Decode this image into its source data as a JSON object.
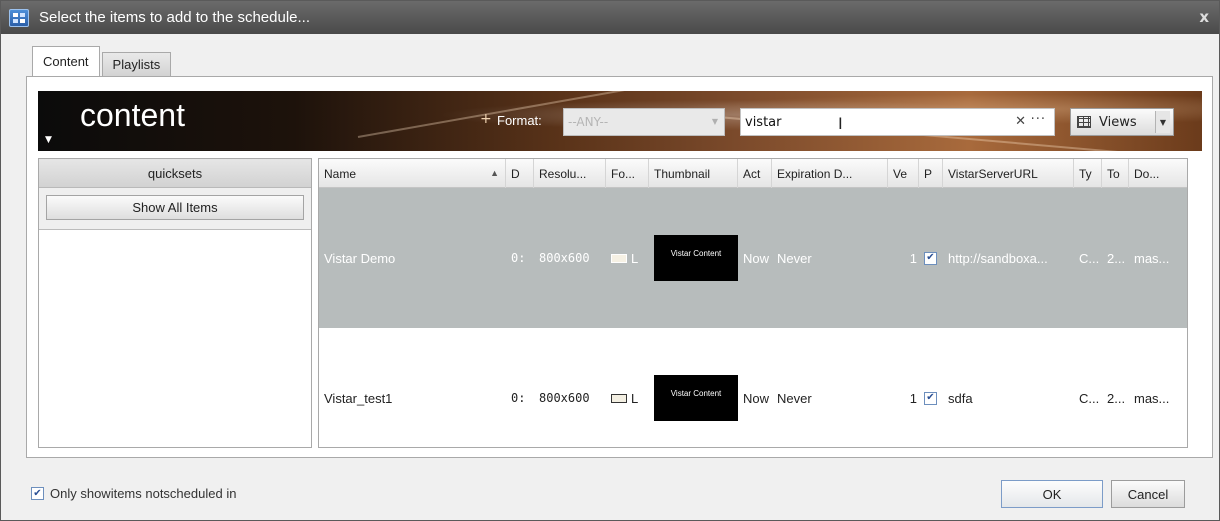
{
  "window": {
    "title": "Select the items to add to the schedule...",
    "close": "x"
  },
  "tabs": [
    {
      "label": "Content",
      "active": true
    },
    {
      "label": "Playlists",
      "active": false
    }
  ],
  "banner": {
    "title": "content",
    "format_label": "Format:",
    "format_value": "--ANY--",
    "search_value": "vistar",
    "search_clear": "✕",
    "search_more": "···",
    "views_label": "Views"
  },
  "quicksets": {
    "header": "quicksets",
    "show_all": "Show All Items"
  },
  "grid": {
    "columns": [
      "Name",
      "D",
      "Resolu...",
      "Fo...",
      "Thumbnail",
      "Act",
      "Expiration D...",
      "Ve",
      "P",
      "VistarServerURL",
      "Ty",
      "To",
      "Do..."
    ],
    "sort": "ascending",
    "rows": [
      {
        "name": "Vistar Demo",
        "d": "0:",
        "resolution": "800x600",
        "format": "L",
        "thumbnail": "Vistar Content",
        "act": "Now",
        "expiration": "Never",
        "ve": "1",
        "p": true,
        "url": "http://sandboxa...",
        "ty": "C...",
        "to": "2...",
        "do": "mas...",
        "selected": true
      },
      {
        "name": "Vistar_test1",
        "d": "0:",
        "resolution": "800x600",
        "format": "L",
        "thumbnail": "Vistar Content",
        "act": "Now",
        "expiration": "Never",
        "ve": "1",
        "p": true,
        "url": "sdfa",
        "ty": "C...",
        "to": "2...",
        "do": "mas...",
        "selected": false
      }
    ]
  },
  "footer": {
    "only_show_label": "Only showitems notscheduled in",
    "only_show_checked": true,
    "ok": "OK",
    "cancel": "Cancel"
  },
  "icons": {
    "title": "schedule-icon",
    "close": "close-icon",
    "grid": "grid-view-icon",
    "checkbox": "check-icon"
  }
}
